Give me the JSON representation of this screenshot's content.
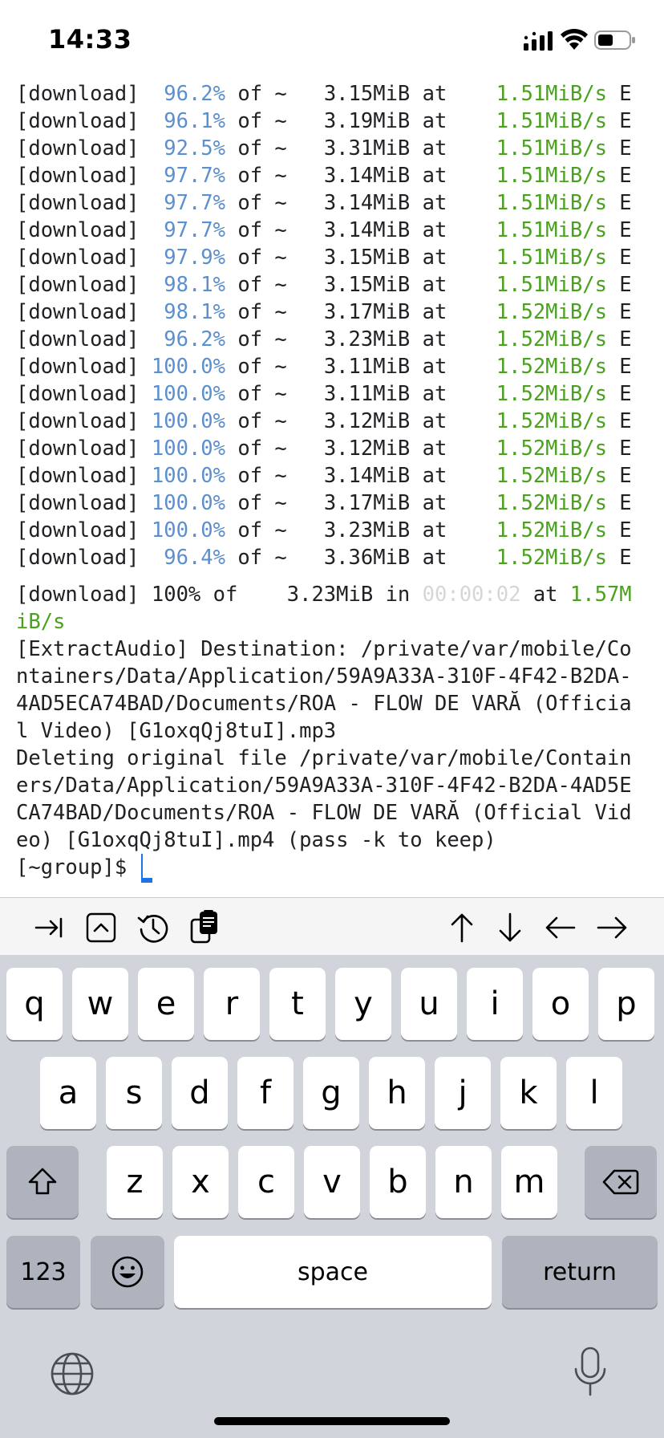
{
  "status_bar": {
    "time": "14:33"
  },
  "terminal": {
    "download_rows": [
      {
        "tag": "[download]",
        "pct": "  96.2%",
        "mid": " of ~   3.15MiB at    ",
        "speed": "1.51MiB/s",
        "tail": " E"
      },
      {
        "tag": "[download]",
        "pct": "  96.1%",
        "mid": " of ~   3.19MiB at    ",
        "speed": "1.51MiB/s",
        "tail": " E"
      },
      {
        "tag": "[download]",
        "pct": "  92.5%",
        "mid": " of ~   3.31MiB at    ",
        "speed": "1.51MiB/s",
        "tail": " E"
      },
      {
        "tag": "[download]",
        "pct": "  97.7%",
        "mid": " of ~   3.14MiB at    ",
        "speed": "1.51MiB/s",
        "tail": " E"
      },
      {
        "tag": "[download]",
        "pct": "  97.7%",
        "mid": " of ~   3.14MiB at    ",
        "speed": "1.51MiB/s",
        "tail": " E"
      },
      {
        "tag": "[download]",
        "pct": "  97.7%",
        "mid": " of ~   3.14MiB at    ",
        "speed": "1.51MiB/s",
        "tail": " E"
      },
      {
        "tag": "[download]",
        "pct": "  97.9%",
        "mid": " of ~   3.15MiB at    ",
        "speed": "1.51MiB/s",
        "tail": " E"
      },
      {
        "tag": "[download]",
        "pct": "  98.1%",
        "mid": " of ~   3.15MiB at    ",
        "speed": "1.51MiB/s",
        "tail": " E"
      },
      {
        "tag": "[download]",
        "pct": "  98.1%",
        "mid": " of ~   3.17MiB at    ",
        "speed": "1.52MiB/s",
        "tail": " E"
      },
      {
        "tag": "[download]",
        "pct": "  96.2%",
        "mid": " of ~   3.23MiB at    ",
        "speed": "1.52MiB/s",
        "tail": " E"
      },
      {
        "tag": "[download]",
        "pct": " 100.0%",
        "mid": " of ~   3.11MiB at    ",
        "speed": "1.52MiB/s",
        "tail": " E"
      },
      {
        "tag": "[download]",
        "pct": " 100.0%",
        "mid": " of ~   3.11MiB at    ",
        "speed": "1.52MiB/s",
        "tail": " E"
      },
      {
        "tag": "[download]",
        "pct": " 100.0%",
        "mid": " of ~   3.12MiB at    ",
        "speed": "1.52MiB/s",
        "tail": " E"
      },
      {
        "tag": "[download]",
        "pct": " 100.0%",
        "mid": " of ~   3.12MiB at    ",
        "speed": "1.52MiB/s",
        "tail": " E"
      },
      {
        "tag": "[download]",
        "pct": " 100.0%",
        "mid": " of ~   3.14MiB at    ",
        "speed": "1.52MiB/s",
        "tail": " E"
      },
      {
        "tag": "[download]",
        "pct": " 100.0%",
        "mid": " of ~   3.17MiB at    ",
        "speed": "1.52MiB/s",
        "tail": " E"
      },
      {
        "tag": "[download]",
        "pct": " 100.0%",
        "mid": " of ~   3.23MiB at    ",
        "speed": "1.52MiB/s",
        "tail": " E"
      },
      {
        "tag": "[download]",
        "pct": "  96.4%",
        "mid": " of ~   3.36MiB at    ",
        "speed": "1.52MiB/s",
        "tail": " E"
      }
    ],
    "final_line": {
      "prefix": "[download] 100% of    3.23MiB in ",
      "elapsed": "00:00:02",
      "mid": " at ",
      "speed_part1": "1.57M",
      "speed_part2": "iB/s"
    },
    "extract_lines": [
      "[ExtractAudio] Destination: /private/var/mobile/Co",
      "ntainers/Data/Application/59A9A33A-310F-4F42-B2DA-",
      "4AD5ECA74BAD/Documents/ROA - FLOW DE VARĂ (Officia",
      "l Video) [G1oxqQj8tuI].mp3"
    ],
    "delete_lines": [
      "Deleting original file /private/var/mobile/Contain",
      "ers/Data/Application/59A9A33A-310F-4F42-B2DA-4AD5E",
      "CA74BAD/Documents/ROA - FLOW DE VARĂ (Official Vid",
      "eo) [G1oxqQj8tuI].mp4 (pass -k to keep)"
    ],
    "prompt": "[~group]$ ",
    "colors": {
      "percent": "#5b8fce",
      "speed": "#4aa11e",
      "elapsed": "#d6d6d6",
      "cursor": "#1a73e8"
    }
  },
  "toolbar": {
    "icons": [
      "tab-icon",
      "control-key-icon",
      "history-icon",
      "paste-icon",
      "arrow-up-icon",
      "arrow-down-icon",
      "arrow-left-icon",
      "arrow-right-icon"
    ]
  },
  "keyboard": {
    "row1": [
      "q",
      "w",
      "e",
      "r",
      "t",
      "y",
      "u",
      "i",
      "o",
      "p"
    ],
    "row2": [
      "a",
      "s",
      "d",
      "f",
      "g",
      "h",
      "j",
      "k",
      "l"
    ],
    "row3": [
      "z",
      "x",
      "c",
      "v",
      "b",
      "n",
      "m"
    ],
    "numbers_label": "123",
    "space_label": "space",
    "return_label": "return"
  }
}
